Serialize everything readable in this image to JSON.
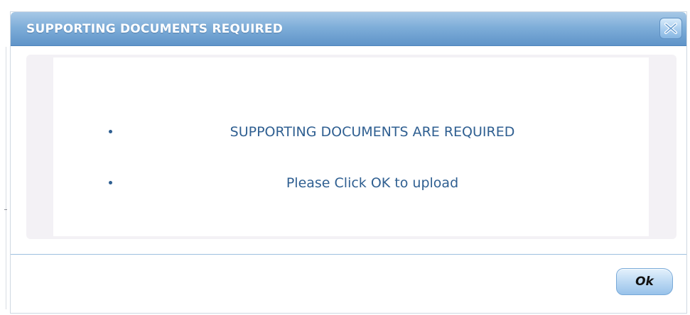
{
  "dialog": {
    "title": "SUPPORTING DOCUMENTS REQUIRED",
    "close_icon": "close-icon",
    "messages": [
      "SUPPORTING DOCUMENTS ARE REQUIRED",
      "Please Click OK to upload"
    ],
    "ok_label": "Ok"
  },
  "colors": {
    "titlebar": "#7faed9",
    "message_text": "#2f5f91",
    "content_panel": "#f3f1f5"
  }
}
